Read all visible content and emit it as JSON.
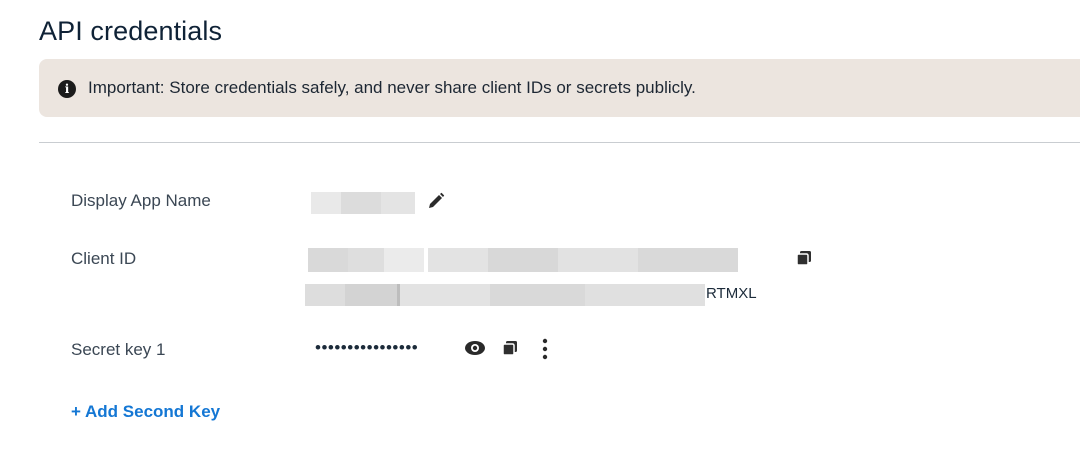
{
  "page": {
    "title": "API credentials"
  },
  "notice": {
    "text": "Important: Store credentials safely, and never share client IDs or secrets publicly.",
    "icon": "info-icon"
  },
  "fields": {
    "display_app_name": {
      "label": "Display App Name"
    },
    "client_id": {
      "label": "Client ID",
      "suffix": "RTMXL"
    },
    "secret_key": {
      "label": "Secret key 1",
      "masked_value": "••••••••••••••••"
    }
  },
  "actions": {
    "add_second_key": "+ Add Second Key"
  },
  "colors": {
    "notice_bg": "#ece5df",
    "link": "#1477d4",
    "text": "#1c2b3a"
  }
}
